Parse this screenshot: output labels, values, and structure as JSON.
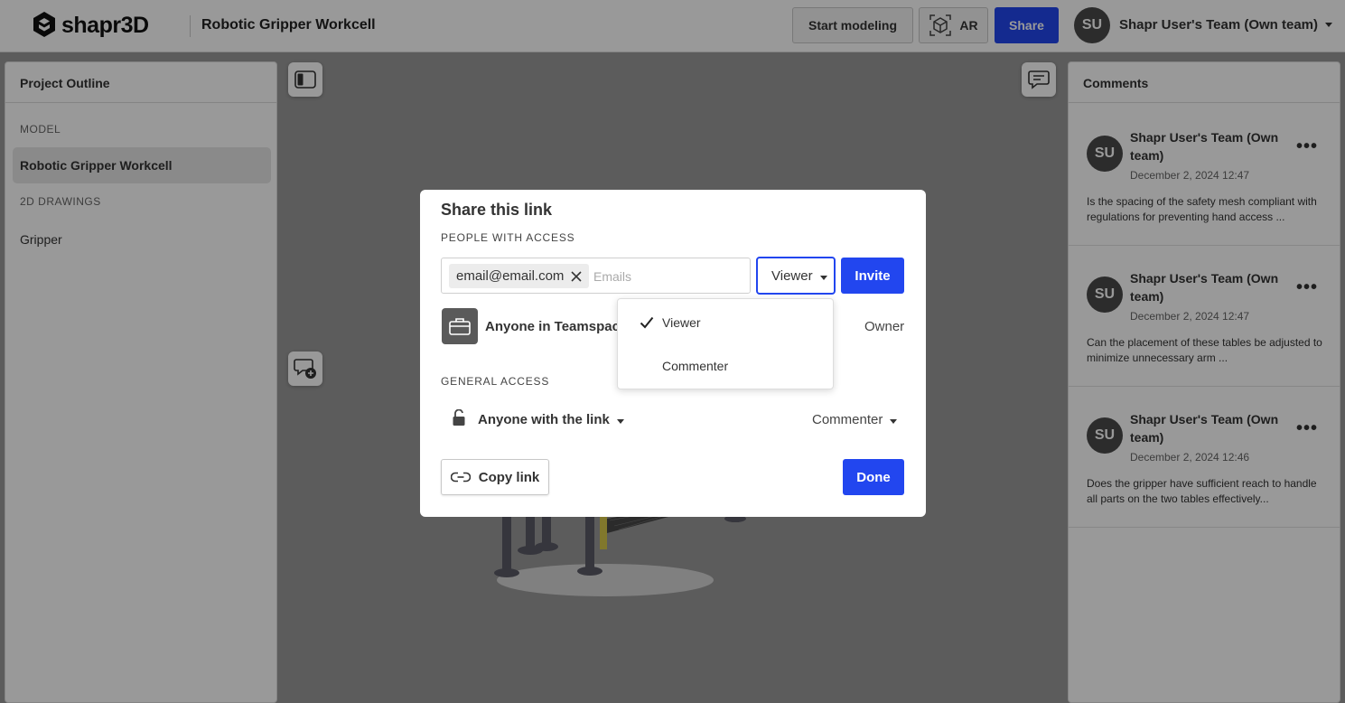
{
  "header": {
    "logo_text": "shapr3D",
    "project_title": "Robotic Gripper Workcell",
    "start_modeling_label": "Start modeling",
    "ar_label": "AR",
    "share_label": "Share",
    "avatar_initials": "SU",
    "team_name": "Shapr User's Team (Own team)"
  },
  "outline": {
    "title": "Project Outline",
    "model_section": "MODEL",
    "model_item": "Robotic Gripper Workcell",
    "drawings_section": "2D DRAWINGS",
    "drawing_item": "Gripper"
  },
  "comments": {
    "title": "Comments",
    "items": [
      {
        "initials": "SU",
        "author": "Shapr User's Team (Own team)",
        "date": "December 2, 2024 12:47",
        "text": "Is the spacing of the safety mesh compliant with regulations for preventing hand access ..."
      },
      {
        "initials": "SU",
        "author": "Shapr User's Team (Own team)",
        "date": "December 2, 2024 12:47",
        "text": "Can the placement of these tables be adjusted to minimize unnecessary arm ..."
      },
      {
        "initials": "SU",
        "author": "Shapr User's Team (Own team)",
        "date": "December 2, 2024 12:46",
        "text": "Does the gripper have sufficient reach to handle all parts on the two tables effectively..."
      }
    ]
  },
  "modal": {
    "title": "Share this link",
    "people_section": "PEOPLE WITH ACCESS",
    "email_chip": "email@email.com",
    "email_placeholder": "Emails",
    "role_selected": "Viewer",
    "invite_label": "Invite",
    "teamspace_label": "Anyone in Teamspace",
    "teamspace_role": "Owner",
    "general_section": "GENERAL ACCESS",
    "link_access_label": "Anyone with the link",
    "link_role": "Commenter",
    "copy_link_label": "Copy link",
    "done_label": "Done"
  },
  "role_dropdown": {
    "options": [
      {
        "label": "Viewer",
        "checked": true
      },
      {
        "label": "Commenter",
        "checked": false
      }
    ]
  },
  "colors": {
    "accent": "#2246ef",
    "overlay": "rgba(0,0,0,0.4)"
  }
}
